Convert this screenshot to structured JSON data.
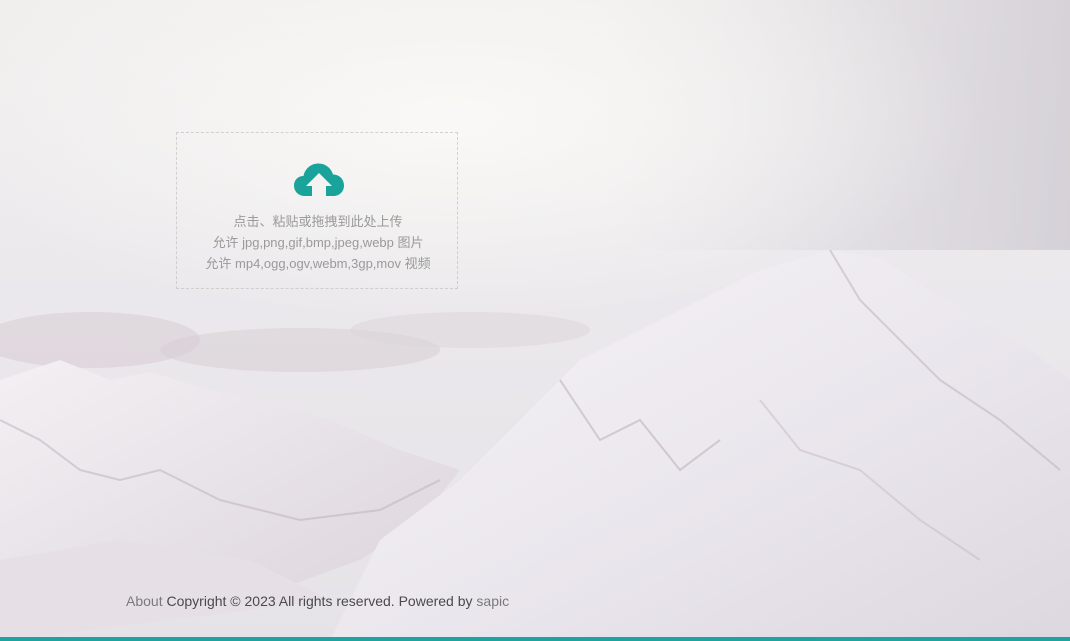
{
  "upload": {
    "icon": "cloud-upload-icon",
    "icon_color": "#1aa39a",
    "line1": "点击、粘贴或拖拽到此处上传",
    "line2": "允许 jpg,png,gif,bmp,jpeg,webp 图片",
    "line3": "允许 mp4,ogg,ogv,webm,3gp,mov 视频"
  },
  "footer": {
    "about_label": "About",
    "copyright_text": "Copyright © 2023 All rights reserved. Powered by",
    "powered_link": "sapic"
  },
  "colors": {
    "accent": "#1fa3a0"
  }
}
